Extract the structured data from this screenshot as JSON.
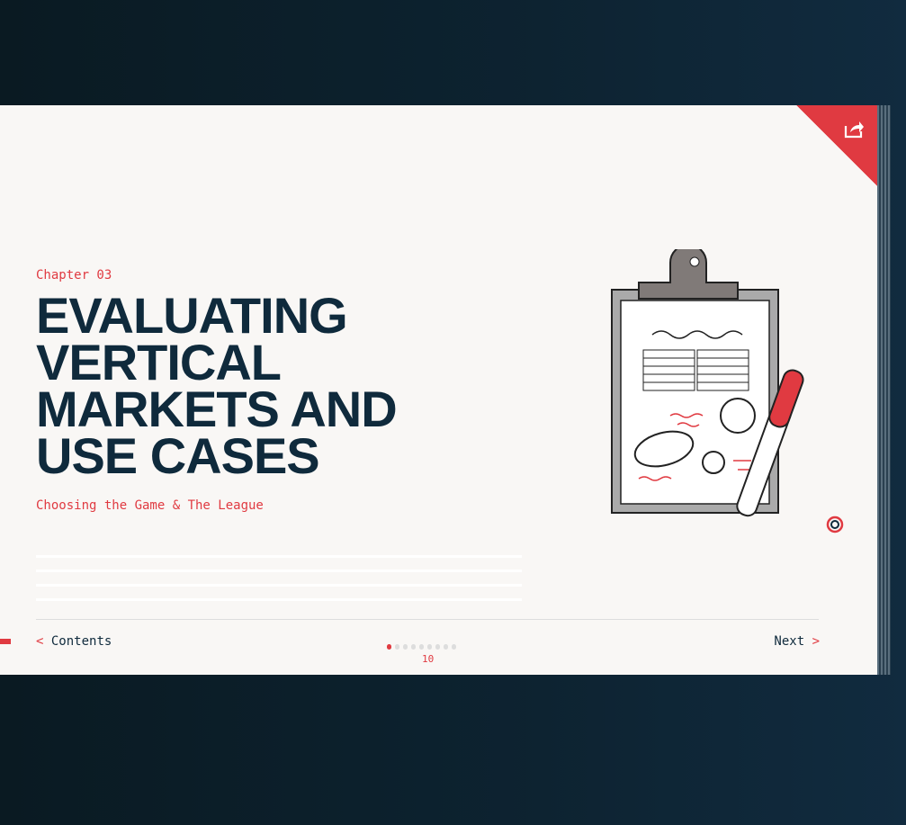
{
  "chapter": "Chapter 03",
  "title_lines": [
    "EVALUATING",
    "VERTICAL",
    "MARKETS AND",
    "USE CASES"
  ],
  "subtitle": "Choosing the Game & The League",
  "nav": {
    "prev_arrow": "<",
    "prev_label": "Contents",
    "next_label": "Next",
    "next_arrow": ">"
  },
  "pagination": {
    "total_dots": 9,
    "active_index": 0,
    "page_number": "10"
  },
  "icons": {
    "share": "share-icon",
    "logo": "brand-logo-icon"
  },
  "colors": {
    "accent": "#e03a41",
    "navy": "#0f2a3c",
    "paper": "#f9f7f5"
  }
}
